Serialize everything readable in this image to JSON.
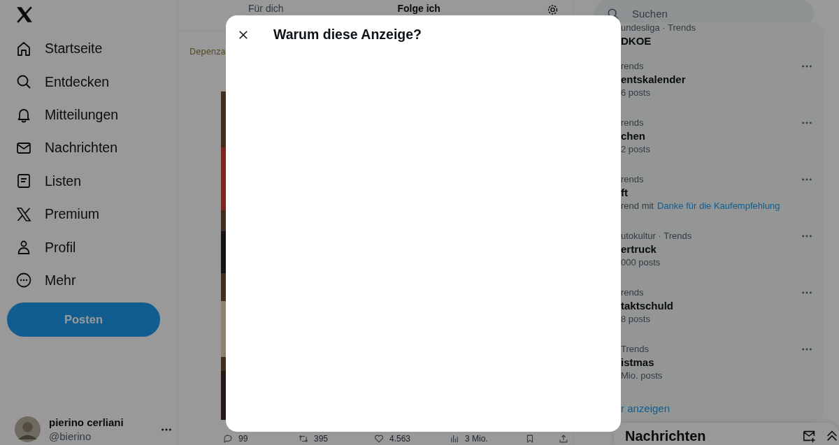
{
  "sidebar": {
    "items": [
      {
        "label": "Startseite",
        "kind": "home"
      },
      {
        "label": "Entdecken",
        "kind": "search"
      },
      {
        "label": "Mitteilungen",
        "kind": "bell"
      },
      {
        "label": "Nachrichten",
        "kind": "mail"
      },
      {
        "label": "Listen",
        "kind": "list"
      },
      {
        "label": "Premium",
        "kind": "x"
      },
      {
        "label": "Profil",
        "kind": "person"
      },
      {
        "label": "Mehr",
        "kind": "more"
      }
    ],
    "post_button": "Posten",
    "account": {
      "name": "pierino cerliani",
      "handle": "@bierino"
    }
  },
  "timeline": {
    "tabs": [
      {
        "label": "Für dich",
        "selected": false
      },
      {
        "label": "Folge ich",
        "selected": true
      }
    ],
    "post": {
      "author_logo": "Depenza",
      "actions": [
        {
          "kind": "reply",
          "count": "99"
        },
        {
          "kind": "repost",
          "count": "395"
        },
        {
          "kind": "like",
          "count": "4.563"
        },
        {
          "kind": "views",
          "count": "3 Mio."
        },
        {
          "kind": "bookmark"
        },
        {
          "kind": "share"
        }
      ]
    }
  },
  "modal": {
    "title": "Warum diese Anzeige?"
  },
  "search": {
    "placeholder": "Suchen"
  },
  "trends": {
    "items": [
      {
        "meta": "undesliga · Trends",
        "title": "DKOE"
      },
      {
        "meta": "rends",
        "title": "entskalender",
        "posts": "6 posts"
      },
      {
        "meta": "rends",
        "title": "chen",
        "posts": "2 posts"
      },
      {
        "meta": "rends",
        "title": "ft",
        "posts": "rend mit",
        "link": "Danke für die Kaufempfehlung"
      },
      {
        "meta": "utokultur · Trends",
        "title": "ertruck",
        "posts": "000 posts"
      },
      {
        "meta": "rends",
        "title": "taktschuld",
        "posts": "8 posts"
      },
      {
        "meta": "Trends",
        "title": "istmas",
        "posts": "Mio. posts"
      }
    ],
    "show_more": "r anzeigen"
  },
  "messages_drawer": {
    "title": "Nachrichten"
  }
}
